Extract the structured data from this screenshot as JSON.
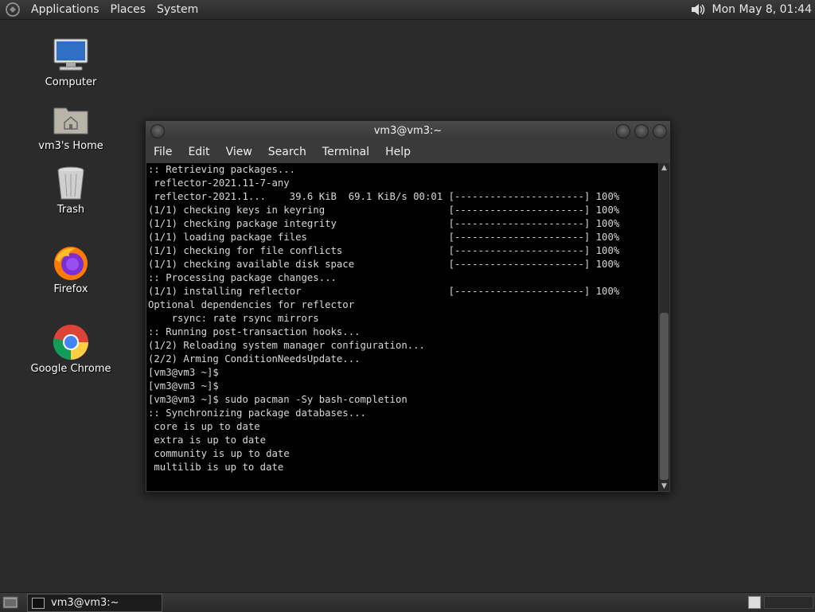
{
  "top_panel": {
    "menus": [
      "Applications",
      "Places",
      "System"
    ],
    "clock": "Mon May  8, 01:44"
  },
  "desktop_icons": [
    {
      "label": "Computer",
      "icon": "computer-icon"
    },
    {
      "label": "vm3's Home",
      "icon": "home-folder-icon"
    },
    {
      "label": "Trash",
      "icon": "trash-icon"
    },
    {
      "label": "Firefox",
      "icon": "firefox-icon"
    },
    {
      "label": "Google Chrome",
      "icon": "chrome-icon"
    }
  ],
  "window": {
    "title": "vm3@vm3:~",
    "menus": [
      "File",
      "Edit",
      "View",
      "Search",
      "Terminal",
      "Help"
    ],
    "lines": [
      ":: Retrieving packages...",
      " reflector-2021.11-7-any",
      " reflector-2021.1...    39.6 KiB  69.1 KiB/s 00:01 [----------------------] 100%",
      "(1/1) checking keys in keyring                     [----------------------] 100%",
      "(1/1) checking package integrity                   [----------------------] 100%",
      "(1/1) loading package files                        [----------------------] 100%",
      "(1/1) checking for file conflicts                  [----------------------] 100%",
      "(1/1) checking available disk space                [----------------------] 100%",
      ":: Processing package changes...",
      "(1/1) installing reflector                         [----------------------] 100%",
      "Optional dependencies for reflector",
      "    rsync: rate rsync mirrors",
      ":: Running post-transaction hooks...",
      "(1/2) Reloading system manager configuration...",
      "(2/2) Arming ConditionNeedsUpdate...",
      "[vm3@vm3 ~]$",
      "[vm3@vm3 ~]$",
      "[vm3@vm3 ~]$ sudo pacman -Sy bash-completion",
      ":: Synchronizing package databases...",
      " core is up to date",
      " extra is up to date",
      " community is up to date",
      " multilib is up to date"
    ]
  },
  "taskbar": {
    "task_label": "vm3@vm3:~"
  }
}
